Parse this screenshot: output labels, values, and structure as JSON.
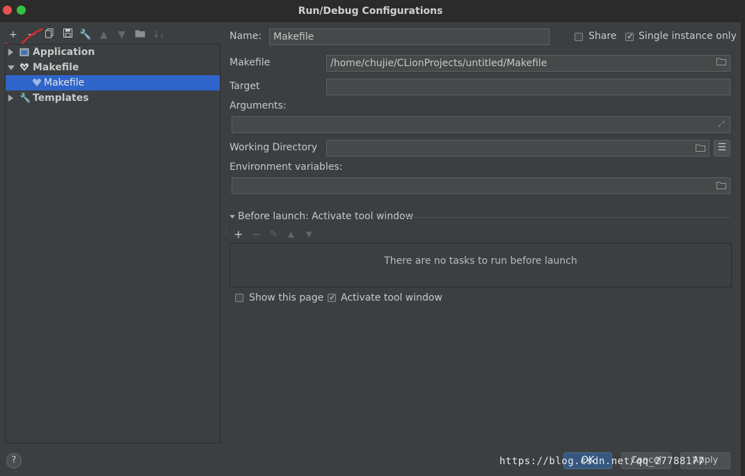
{
  "window": {
    "title": "Run/Debug Configurations",
    "controls": [
      "close",
      "maximize"
    ]
  },
  "toolbar": {
    "icons": [
      "add-icon",
      "remove-icon",
      "copy-icon",
      "save-icon",
      "wrench-icon",
      "move-up-icon",
      "move-down-icon",
      "new-folder-icon",
      "sort-icon"
    ]
  },
  "tree": {
    "items": [
      {
        "label": "Application",
        "expanded": false,
        "icon": "application-icon"
      },
      {
        "label": "Makefile",
        "expanded": true,
        "icon": "makefile-icon"
      },
      {
        "label": "Makefile",
        "selected": true,
        "icon": "makefile-icon"
      },
      {
        "label": "Templates",
        "expanded": false,
        "icon": "wrench-icon"
      }
    ]
  },
  "form": {
    "name_label": "Name:",
    "name_value": "Makefile",
    "share_label": "Share",
    "share_checked": false,
    "single_instance_label": "Single instance only",
    "single_instance_checked": true,
    "makefile_label": "Makefile",
    "makefile_value": "/home/chujie/CLionProjects/untitled/Makefile",
    "target_label": "Target",
    "target_value": "",
    "arguments_label": "Arguments:",
    "arguments_value": "",
    "working_dir_label": "Working Directory",
    "working_dir_value": "",
    "env_label": "Environment variables:",
    "env_value": ""
  },
  "before_launch": {
    "header": "Before launch: Activate tool window",
    "empty_text": "There are no tasks to run before launch",
    "show_page_label": "Show this page",
    "show_page_checked": false,
    "activate_label": "Activate tool window",
    "activate_checked": true
  },
  "footer": {
    "help": "?",
    "ok": "OK",
    "cancel": "Cancel",
    "apply": "Apply"
  },
  "watermark": "https://blog.csdn.net/qq_27788177",
  "colors": {
    "background": "#3c3f41",
    "selection": "#2f65ca",
    "ok_button": "#365880",
    "close": "#e8524c",
    "maximize": "#36c23e"
  }
}
